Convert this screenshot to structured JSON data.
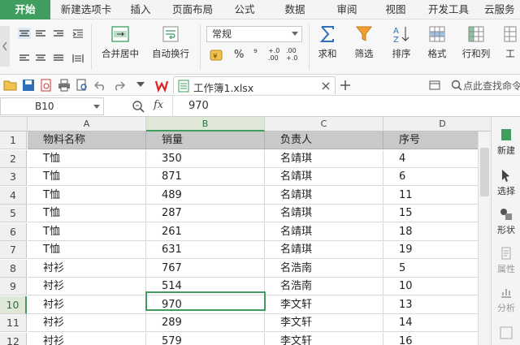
{
  "menu_tabs": [
    "开始",
    "新建选项卡",
    "插入",
    "页面布局",
    "公式",
    "数据",
    "审阅",
    "视图",
    "开发工具",
    "云服务"
  ],
  "ribbon": {
    "merge_center": "合并居中",
    "auto_wrap": "自动换行",
    "number_format": "常规",
    "percent": "%",
    "thousands": "⁹",
    "dec_increase": "+.0\n.00",
    "dec_decrease": ".00\n+.0",
    "sum": "求和",
    "filter": "筛选",
    "sort": "排序",
    "format": "格式",
    "row_col": "行和列",
    "worksheet": "工"
  },
  "quickbar": {
    "file_name": "工作簿1.xlsx",
    "search_hint": "点此查找命令"
  },
  "formula_bar": {
    "cell_ref": "B10",
    "fx": "fx",
    "value": "970"
  },
  "columns": [
    "A",
    "B",
    "C",
    "D"
  ],
  "rows": [
    {
      "num": "1",
      "cells": [
        "物料名称",
        "销量",
        "负责人",
        "序号"
      ]
    },
    {
      "num": "2",
      "cells": [
        "T恤",
        "350",
        "名靖琪",
        "4"
      ]
    },
    {
      "num": "3",
      "cells": [
        "T恤",
        "871",
        "名靖琪",
        "6"
      ]
    },
    {
      "num": "4",
      "cells": [
        "T恤",
        "489",
        "名靖琪",
        "11"
      ]
    },
    {
      "num": "5",
      "cells": [
        "T恤",
        "287",
        "名靖琪",
        "15"
      ]
    },
    {
      "num": "6",
      "cells": [
        "T恤",
        "261",
        "名靖琪",
        "18"
      ]
    },
    {
      "num": "7",
      "cells": [
        "T恤",
        "631",
        "名靖琪",
        "19"
      ]
    },
    {
      "num": "8",
      "cells": [
        "衬衫",
        "767",
        "名浩南",
        "5"
      ]
    },
    {
      "num": "9",
      "cells": [
        "衬衫",
        "514",
        "名浩南",
        "10"
      ]
    },
    {
      "num": "10",
      "cells": [
        "衬衫",
        "970",
        "李文轩",
        "13"
      ]
    },
    {
      "num": "11",
      "cells": [
        "衬衫",
        "289",
        "李文轩",
        "14"
      ]
    },
    {
      "num": "12",
      "cells": [
        "衬衫",
        "579",
        "李文轩",
        "16"
      ]
    }
  ],
  "side_panel": [
    "新建",
    "选择",
    "形状",
    "属性",
    "分析"
  ],
  "colors": {
    "accent": "#3f9e5f",
    "header_fill": "#c9c9c9"
  }
}
